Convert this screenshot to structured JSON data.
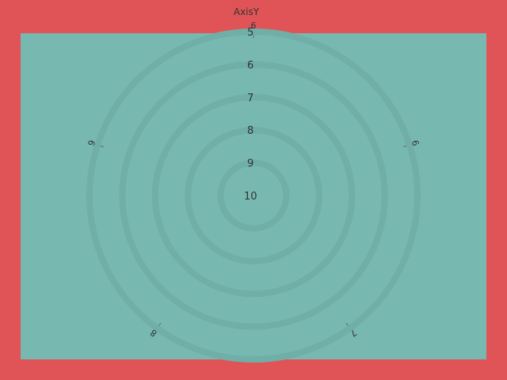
{
  "chart_data": {
    "type": "polar",
    "ylabel": "AxisY",
    "radial_axis": {
      "ticks": [
        "5",
        "6",
        "7",
        "8",
        "9",
        "10"
      ],
      "range": [
        10,
        5
      ],
      "reversed": true,
      "grid": true
    },
    "angular_axis": {
      "ticks": [
        "6",
        "6",
        "7",
        "8",
        "9"
      ],
      "grid": false
    },
    "series": []
  },
  "colors": {
    "background": "#e05457",
    "plot_area": "#77b8b0",
    "grid": "#6fafa7",
    "tick_text": "#333333",
    "tick_mark": "#666666"
  }
}
